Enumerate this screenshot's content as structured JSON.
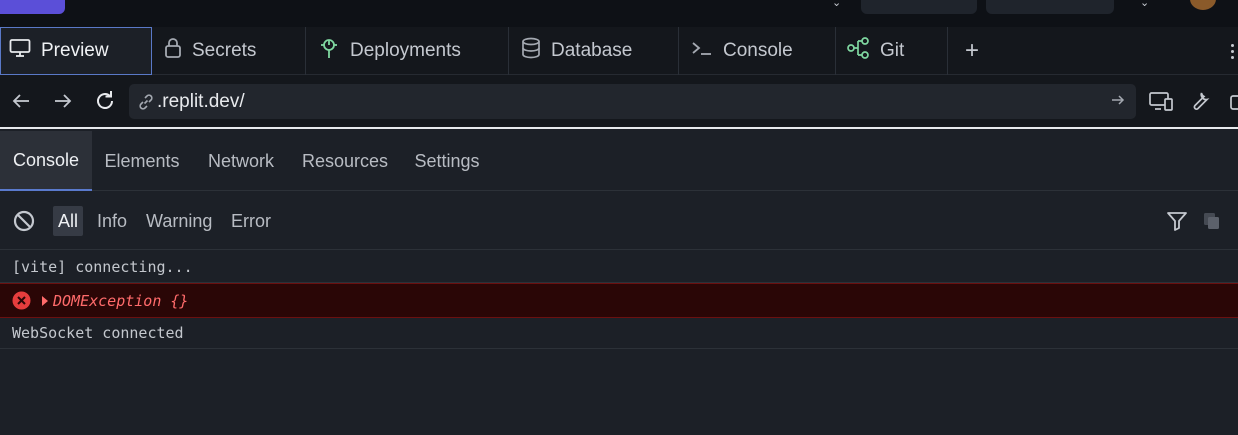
{
  "workspace": {
    "tabs": [
      {
        "label": "Preview",
        "icon": "monitor-icon"
      },
      {
        "label": "Secrets",
        "icon": "lock-icon"
      },
      {
        "label": "Deployments",
        "icon": "deploy-icon"
      },
      {
        "label": "Database",
        "icon": "database-icon"
      },
      {
        "label": "Console",
        "icon": "terminal-icon"
      },
      {
        "label": "Git",
        "icon": "git-icon"
      }
    ],
    "add_tab": "+"
  },
  "browser": {
    "url": ".replit.dev/"
  },
  "devtools": {
    "tabs": [
      "Console",
      "Elements",
      "Network",
      "Resources",
      "Settings"
    ],
    "filters": [
      "All",
      "Info",
      "Warning",
      "Error"
    ],
    "logs": [
      {
        "level": "info",
        "text": "[vite] connecting..."
      },
      {
        "level": "error",
        "text": "DOMException {}"
      },
      {
        "level": "info",
        "text": "WebSocket connected"
      }
    ]
  },
  "colors": {
    "accent": "#5a79c8",
    "error_bg": "#2a0606",
    "error_text": "#ff6b6b",
    "git_green": "#7fd7a0"
  }
}
